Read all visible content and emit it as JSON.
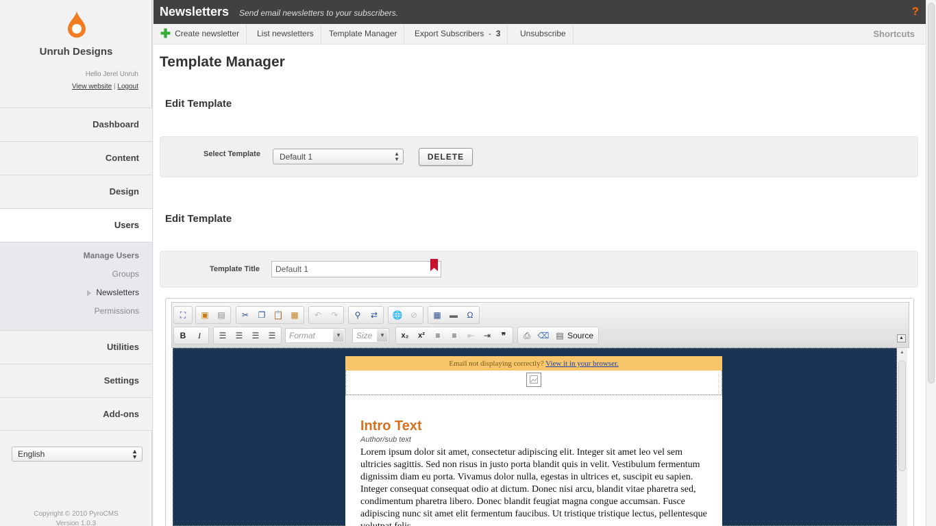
{
  "sidebar": {
    "site_name": "Unruh Designs",
    "hello": "Hello Jerel Unruh",
    "view_website": "View website",
    "separator": "|",
    "logout": "Logout",
    "nav": {
      "dashboard": "Dashboard",
      "content": "Content",
      "design": "Design",
      "users": "Users",
      "utilities": "Utilities",
      "settings": "Settings",
      "addons": "Add-ons"
    },
    "subnav": {
      "manage_users": "Manage Users",
      "groups": "Groups",
      "newsletters": "Newsletters",
      "permissions": "Permissions"
    },
    "language": "English",
    "copyright": "Copyright © 2010 PyroCMS",
    "version": "Version 1.0.3"
  },
  "header": {
    "title": "Newsletters",
    "subtitle": "Send email newsletters to your subscribers.",
    "help": "?"
  },
  "toolbar": {
    "create": "Create newsletter",
    "list": "List newsletters",
    "template_manager": "Template Manager",
    "export": "Export Subscribers",
    "export_sep": "-",
    "export_count": "3",
    "unsubscribe": "Unsubscribe",
    "shortcuts": "Shortcuts"
  },
  "main": {
    "page_title": "Template Manager",
    "section1_title": "Edit Template",
    "select_label": "Select Template",
    "select_value": "Default 1",
    "delete_label": "DELETE",
    "section2_title": "Edit Template",
    "title_label": "Template Title",
    "title_value": "Default 1"
  },
  "editor": {
    "format_placeholder": "Format",
    "size_placeholder": "Size",
    "source_label": "Source",
    "email": {
      "banner_text": "Email not displaying correctly?",
      "banner_link": "View it in your browser.",
      "intro_title": "Intro Text",
      "author": "Author/sub text",
      "body": "Lorem ipsum dolor sit amet, consectetur adipiscing elit. Integer sit amet leo vel sem ultricies sagittis. Sed non risus in justo porta blandit quis in velit. Vestibulum fermentum dignissim diam eu porta. Vivamus dolor nulla, egestas in ultrices et, suscipit eu sapien. Integer consequat consequat odio at dictum. Donec nisi arcu, blandit vitae pharetra sed, condimentum pharetra libero. Donec blandit feugiat magna congue accumsan. Fusce adipiscing nunc sit amet elit fermentum faucibus. Ut tristique tristique lectus, pellentesque volutpat felis"
    }
  },
  "colors": {
    "accent": "#ff6600",
    "topbar": "#414141",
    "email_bg": "#1a3553",
    "banner": "#f8c66a",
    "intro_title": "#d4701e"
  }
}
